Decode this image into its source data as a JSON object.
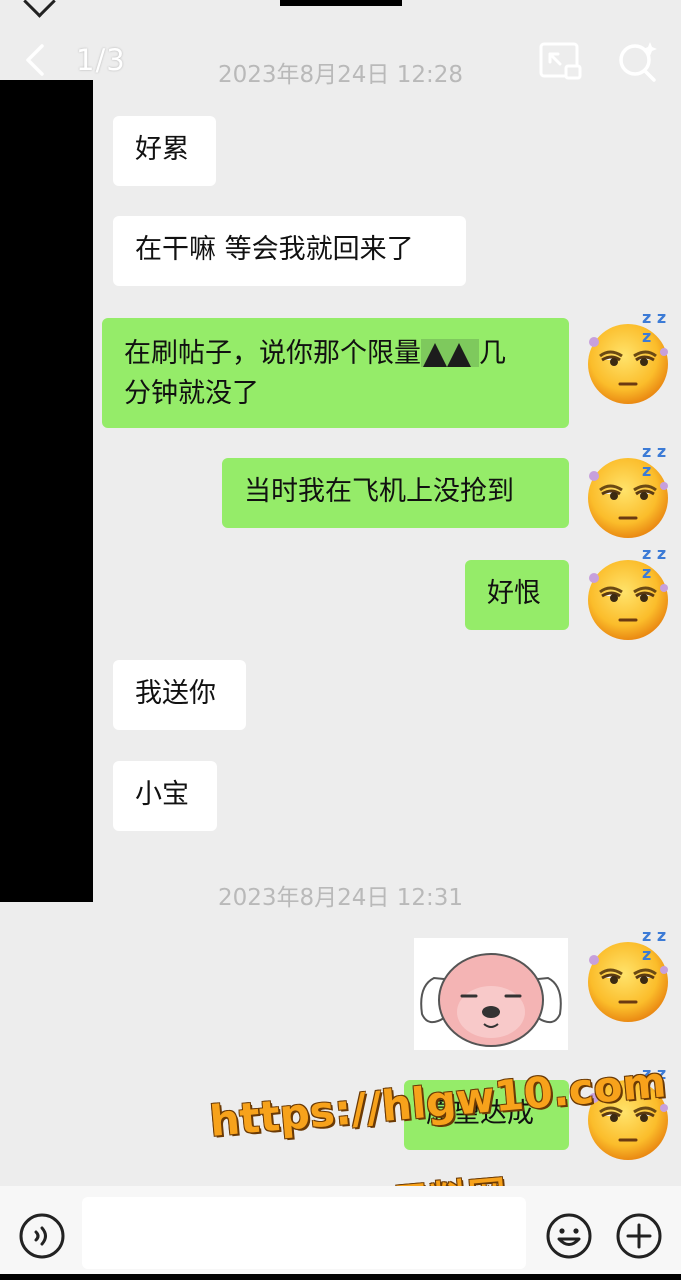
{
  "header": {
    "counter": "1/3"
  },
  "timestamps": [
    "2023年8月24日 12:28",
    "2023年8月24日 12:31"
  ],
  "messages": [
    {
      "dir": "in",
      "text": "好累"
    },
    {
      "dir": "in",
      "text": "在干嘛 等会我就回来了"
    },
    {
      "dir": "out",
      "line1_a": "在刷帖子，说你那个限量",
      "line1_b": "几",
      "line2": "分钟就没了"
    },
    {
      "dir": "out",
      "text": "当时我在飞机上没抢到"
    },
    {
      "dir": "out",
      "text": "好恨"
    },
    {
      "dir": "in",
      "text": "我送你"
    },
    {
      "dir": "in",
      "text": "小宝"
    },
    {
      "dir": "out",
      "type": "sticker",
      "sticker": "pink-puppy-sticker"
    },
    {
      "dir": "out",
      "text": "愿望达成"
    }
  ],
  "avatar": {
    "icon": "sleepy-face-emoji-avatar",
    "zz": "z z z"
  },
  "watermark": {
    "url": "https://hlgw10.com",
    "name": "黑料网"
  },
  "colors": {
    "incoming": "#ffffff",
    "outgoing": "#95ec69",
    "background": "#ededed"
  },
  "icons": {
    "back": "chevron-left-icon",
    "share": "share-screen-icon",
    "search": "search-sparkle-icon",
    "voice": "voice-icon",
    "emoji": "emoji-icon",
    "add": "add-icon"
  }
}
